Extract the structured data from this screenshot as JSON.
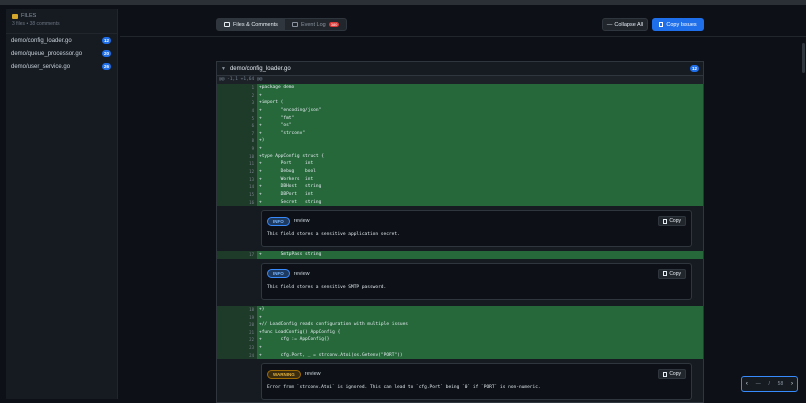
{
  "sidebar": {
    "title": "FILES",
    "subtitle": "3 files • 38 comments",
    "items": [
      {
        "label": "demo/config_loader.go",
        "count": "12"
      },
      {
        "label": "demo/queue_processor.go",
        "count": "20"
      },
      {
        "label": "demo/user_service.go",
        "count": "26"
      }
    ]
  },
  "toolbar": {
    "tab_files": "Files & Comments",
    "tab_events": "Event Log",
    "event_badge": "380",
    "collapse_all": "Collapse All",
    "copy_issues": "Copy Issues"
  },
  "file": {
    "name": "demo/config_loader.go",
    "count": "12",
    "hunk": "@@ -1,1 +1,64 @@",
    "lines1": [
      {
        "n": "1",
        "code": "+package demo"
      },
      {
        "n": "2",
        "code": "+"
      },
      {
        "n": "3",
        "code": "+import ("
      },
      {
        "n": "4",
        "code": "+       \"encoding/json\""
      },
      {
        "n": "5",
        "code": "+       \"fmt\""
      },
      {
        "n": "6",
        "code": "+       \"os\""
      },
      {
        "n": "7",
        "code": "+       \"strconv\""
      },
      {
        "n": "8",
        "code": "+)"
      },
      {
        "n": "9",
        "code": "+"
      },
      {
        "n": "10",
        "code": "+type AppConfig struct {"
      },
      {
        "n": "11",
        "code": "+       Port     int"
      },
      {
        "n": "12",
        "code": "+       Debug    bool"
      },
      {
        "n": "13",
        "code": "+       Workers  int"
      },
      {
        "n": "14",
        "code": "+       DBHost   string"
      },
      {
        "n": "15",
        "code": "+       DBPort   int"
      },
      {
        "n": "16",
        "code": "+       Secret   string"
      }
    ],
    "comment1": {
      "severity": "INFO",
      "author": "review",
      "copy": "Copy",
      "body": "This field stores a sensitive application secret."
    },
    "lines2": [
      {
        "n": "17",
        "code": "+       SmtpPass string"
      }
    ],
    "comment2": {
      "severity": "INFO",
      "author": "review",
      "copy": "Copy",
      "body": "This field stores a sensitive SMTP password."
    },
    "lines3": [
      {
        "n": "18",
        "code": "+}"
      },
      {
        "n": "19",
        "code": "+"
      },
      {
        "n": "20",
        "code": "+// LoadConfig reads configuration with multiple issues"
      },
      {
        "n": "21",
        "code": "+func LoadConfig() AppConfig {"
      },
      {
        "n": "22",
        "code": "+       cfg := AppConfig{}"
      },
      {
        "n": "23",
        "code": "+"
      },
      {
        "n": "24",
        "code": "+       cfg.Port, _ = strconv.Atoi(os.Getenv(\"PORT\"))"
      }
    ],
    "comment3": {
      "severity": "WARNING",
      "author": "review",
      "copy": "Copy",
      "body": "Error from `strconv.Atoi` is ignored. This can lead to `cfg.Port` being `0` if `PORT` is non-numeric."
    }
  },
  "pager": {
    "prev": "‹",
    "current": "—",
    "sep": "/",
    "total": "58",
    "next": "›"
  }
}
